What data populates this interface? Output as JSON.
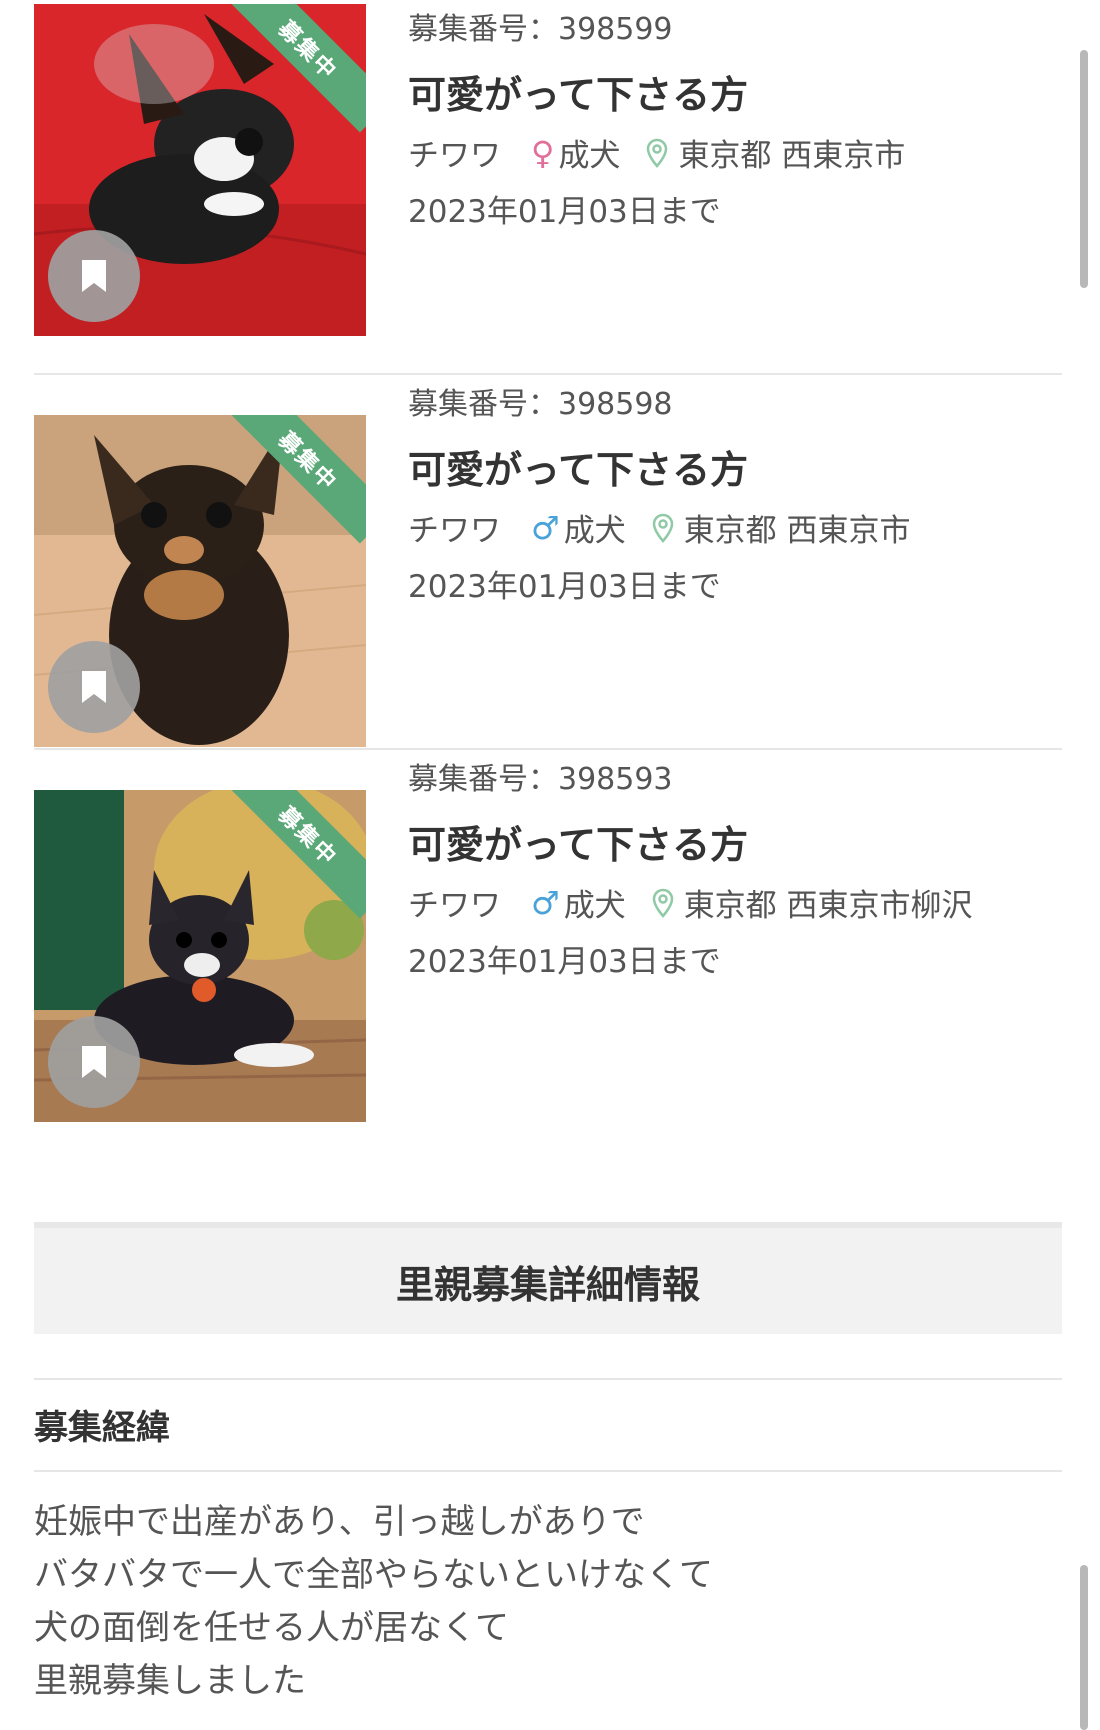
{
  "listings": [
    {
      "recruit_number": "募集番号：398599",
      "title": "可愛がって下さる方",
      "breed": "チワワ",
      "gender_symbol": "♀",
      "gender_color": "#e0709a",
      "age": "成犬",
      "location": "東京都 西東京市",
      "deadline": "2023年01月03日まで",
      "status_ribbon": "募集中",
      "photo_background": "#d8262a"
    },
    {
      "recruit_number": "募集番号：398598",
      "title": "可愛がって下さる方",
      "breed": "チワワ",
      "gender_symbol": "♂",
      "gender_color": "#4aa3d8",
      "age": "成犬",
      "location": "東京都 西東京市",
      "deadline": "2023年01月03日まで",
      "status_ribbon": "募集中",
      "photo_background": "#e2b893"
    },
    {
      "recruit_number": "募集番号：398593",
      "title": "可愛がって下さる方",
      "breed": "チワワ",
      "gender_symbol": "♂",
      "gender_color": "#4aa3d8",
      "age": "成犬",
      "location": "東京都 西東京市柳沢",
      "deadline": "2023年01月03日まで",
      "status_ribbon": "募集中",
      "photo_background": "#c79a6a"
    }
  ],
  "details": {
    "section_title": "里親募集詳細情報",
    "subheading": "募集経緯",
    "body_lines": [
      "妊娠中で出産があり、引っ越しがありで",
      "バタバタで一人で全部やらないといけなくて",
      "犬の面倒を任せる人が居なくて",
      "里親募集しました"
    ]
  },
  "colors": {
    "ribbon_green": "#5aa878",
    "location_pin": "#8fc9a6",
    "bookmark_bg": "#a0a0a0"
  }
}
